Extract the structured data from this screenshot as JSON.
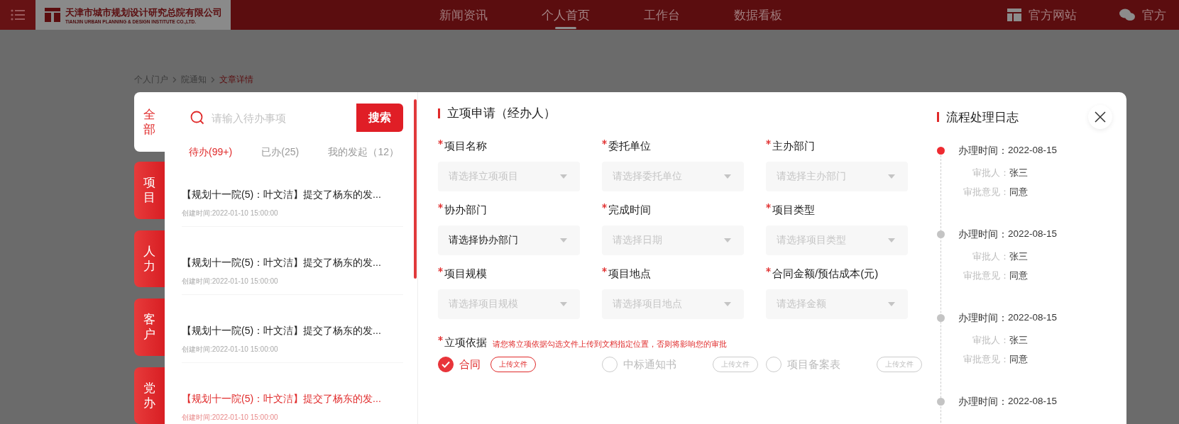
{
  "topbar": {
    "logo": {
      "name": "天津市城市规划设计研究总院有限公司",
      "subtitle": "TIANJIN URBAN PLANNING & DESIGN INSTITUTE CO.,LTD."
    },
    "nav": [
      {
        "label": "新闻资讯",
        "selected": false
      },
      {
        "label": "个人首页",
        "selected": true
      },
      {
        "label": "工作台",
        "selected": false
      },
      {
        "label": "数据看板",
        "selected": false
      }
    ],
    "links": [
      {
        "kind": "site",
        "label": "官方网站"
      },
      {
        "kind": "wechat",
        "label": "官方"
      }
    ]
  },
  "breadcrumb": [
    {
      "label": "个人门户",
      "selected": false
    },
    {
      "label": "院通知",
      "selected": false
    },
    {
      "label": "文章详情",
      "selected": true
    }
  ],
  "side_tabs": [
    {
      "label": "全部",
      "selected": true
    },
    {
      "label": "项目",
      "selected": false
    },
    {
      "label": "人力",
      "selected": false
    },
    {
      "label": "客户",
      "selected": false
    },
    {
      "label": "党办",
      "selected": false
    }
  ],
  "todo": {
    "search": {
      "placeholder": "请输入待办事项",
      "button": "搜索"
    },
    "tabs": [
      {
        "label": "待办(99+)",
        "selected": true
      },
      {
        "label": "已办(25)",
        "selected": false
      },
      {
        "label": "我的发起（12）",
        "selected": false
      }
    ],
    "items": [
      {
        "title": "【规划十一院(5)：叶文洁】提交了杨东的发...",
        "time": "创建时间:2022-01-10 15:00:00",
        "selected": false
      },
      {
        "title": "【规划十一院(5)：叶文洁】提交了杨东的发...",
        "time": "创建时间:2022-01-10 15:00:00",
        "selected": false
      },
      {
        "title": "【规划十一院(5)：叶文洁】提交了杨东的发...",
        "time": "创建时间:2022-01-10 15:00:00",
        "selected": false
      },
      {
        "title": "【规划十一院(5)：叶文洁】提交了杨东的发...",
        "time": "创建时间:2022-01-10 15:00:00",
        "selected": true
      }
    ]
  },
  "form": {
    "title": "立项申请（经办人）",
    "fields": [
      {
        "label": "项目名称",
        "required": true,
        "placeholder": "请选择立项项目"
      },
      {
        "label": "委托单位",
        "required": true,
        "placeholder": "请选择委托单位"
      },
      {
        "label": "主办部门",
        "required": true,
        "placeholder": "请选择主办部门"
      },
      {
        "label": "协办部门",
        "required": true,
        "value": "请选择协办部门"
      },
      {
        "label": "完成时间",
        "required": true,
        "placeholder": "请选择日期"
      },
      {
        "label": "项目类型",
        "required": true,
        "placeholder": "请选择项目类型"
      },
      {
        "label": "项目规模",
        "required": true,
        "placeholder": "请选择项目规模"
      },
      {
        "label": "项目地点",
        "required": true,
        "placeholder": "请选择项目地点"
      },
      {
        "label": "合同金额/预估成本(元)",
        "required": true,
        "placeholder": "请选择金额"
      }
    ],
    "basis": {
      "label": "立项依据",
      "required": true,
      "note": "请您将立项依据勾选文件上传到文档指定位置，否则将影响您的审批",
      "options": [
        {
          "label": "合同",
          "checked": true,
          "upload": "上传文件"
        },
        {
          "label": "中标通知书",
          "checked": false,
          "upload": "上传文件"
        },
        {
          "label": "项目备案表",
          "checked": false,
          "upload": "上传文件"
        }
      ]
    }
  },
  "log": {
    "title": "流程处理日志",
    "entries": [
      {
        "active": true,
        "time_label": "办理时间：",
        "time": "2022-08-15",
        "approver_label": "审批人：",
        "approver": "张三",
        "opinion_label": "审批意见：",
        "opinion": "同意"
      },
      {
        "active": false,
        "time_label": "办理时间：",
        "time": "2022-08-15",
        "approver_label": "审批人：",
        "approver": "张三",
        "opinion_label": "审批意见：",
        "opinion": "同意"
      },
      {
        "active": false,
        "time_label": "办理时间：",
        "time": "2022-08-15",
        "approver_label": "审批人：",
        "approver": "张三",
        "opinion_label": "审批意见：",
        "opinion": "同意"
      },
      {
        "active": false,
        "time_label": "办理时间：",
        "time": "2022-08-15"
      }
    ]
  }
}
